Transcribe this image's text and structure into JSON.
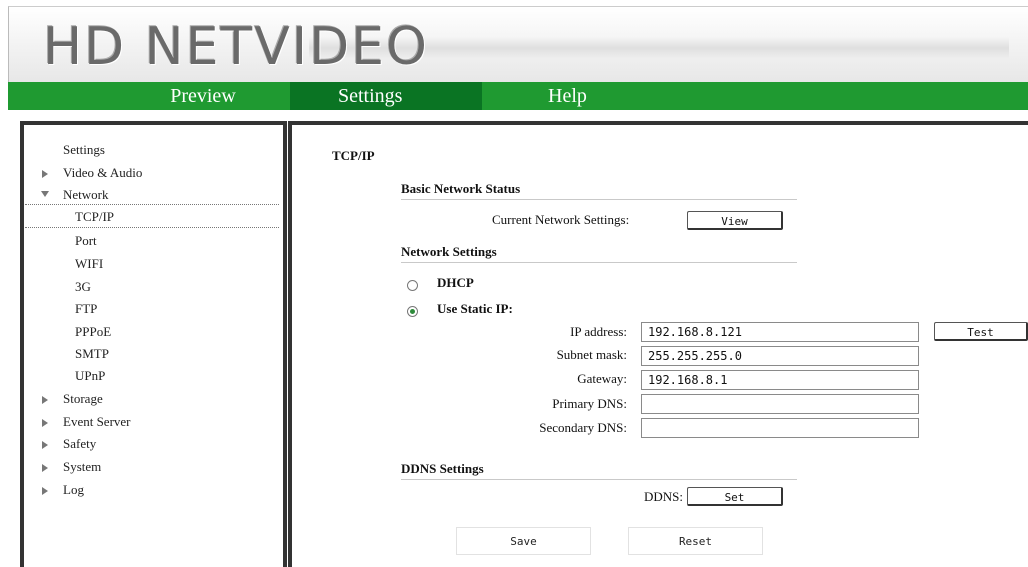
{
  "header": {
    "logo": "HD NETVIDEO"
  },
  "nav": {
    "tabs": [
      "Preview",
      "Settings",
      "Help"
    ],
    "active": "Settings"
  },
  "sidebar": {
    "title": "Settings",
    "groups": [
      "Video & Audio",
      "Network",
      "Storage",
      "Event Server",
      "Safety",
      "System",
      "Log"
    ],
    "network_items": [
      "TCP/IP",
      "Port",
      "WIFI",
      "3G",
      "FTP",
      "PPPoE",
      "SMTP",
      "UPnP"
    ],
    "selected": "TCP/IP"
  },
  "page": {
    "title": "TCP/IP",
    "basic": {
      "heading": "Basic Network Status",
      "current_label": "Current Network Settings:",
      "view_button": "View"
    },
    "network": {
      "heading": "Network Settings",
      "dhcp_label": "DHCP",
      "dhcp_selected": false,
      "static_label": "Use Static IP:",
      "static_selected": true,
      "ip_label": "IP address:",
      "ip_value": "192.168.8.121",
      "test_button": "Test",
      "mask_label": "Subnet mask:",
      "mask_value": "255.255.255.0",
      "gateway_label": "Gateway:",
      "gateway_value": "192.168.8.1",
      "dns1_label": "Primary DNS:",
      "dns1_value": "",
      "dns2_label": "Secondary DNS:",
      "dns2_value": ""
    },
    "ddns": {
      "heading": "DDNS Settings",
      "label": "DDNS:",
      "set_button": "Set"
    },
    "actions": {
      "save": "Save",
      "reset": "Reset"
    }
  },
  "colors": {
    "nav_green": "#1f9a31",
    "nav_active": "#0a7423",
    "frame": "#333333"
  }
}
